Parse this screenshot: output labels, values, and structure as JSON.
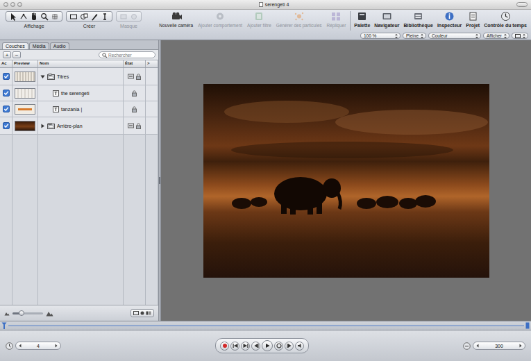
{
  "window": {
    "title": "serengeti 4"
  },
  "toolbar": {
    "tool_groups": [
      {
        "label": "Affichage",
        "disabled": false
      },
      {
        "label": "Créer",
        "disabled": false
      },
      {
        "label": "Masque",
        "disabled": true
      }
    ],
    "actions": [
      {
        "label": "Nouvelle caméra",
        "disabled": false
      },
      {
        "label": "Ajouter comportement",
        "disabled": true
      },
      {
        "label": "Ajouter filtre",
        "disabled": true
      },
      {
        "label": "Générer des particules",
        "disabled": true
      },
      {
        "label": "Répliquer",
        "disabled": true
      }
    ],
    "panels": [
      {
        "label": "Palette"
      },
      {
        "label": "Navigateur"
      },
      {
        "label": "Bibliothèque"
      },
      {
        "label": "Inspecteur"
      },
      {
        "label": "Projet"
      },
      {
        "label": "Contrôle du temps"
      }
    ]
  },
  "view_controls": [
    {
      "label": "100 %"
    },
    {
      "label": "Pleine"
    },
    {
      "label": "Couleur"
    },
    {
      "label": "Afficher"
    }
  ],
  "layers_panel": {
    "tabs": [
      {
        "label": "Couches",
        "selected": true
      },
      {
        "label": "Média",
        "selected": false
      },
      {
        "label": "Audio",
        "selected": false
      }
    ],
    "add_button": "+",
    "remove_button": "−",
    "search": {
      "placeholder": "Rechercher"
    },
    "columns": [
      "Ac",
      "Preview",
      "Nom",
      "État",
      ">"
    ],
    "rows": [
      {
        "name": "Titres",
        "kind": "group",
        "checked": true,
        "expanded": true,
        "children": [
          {
            "name": "the serengeti",
            "kind": "text",
            "checked": true
          },
          {
            "name": "tanzania |",
            "kind": "text",
            "checked": true
          }
        ]
      },
      {
        "name": "Arrière-plan",
        "kind": "group",
        "checked": true,
        "expanded": false,
        "children": []
      }
    ],
    "thumbnail_size": {
      "level": 0.3
    }
  },
  "timeline": {
    "current_frame": "4",
    "end_frame": "300"
  }
}
